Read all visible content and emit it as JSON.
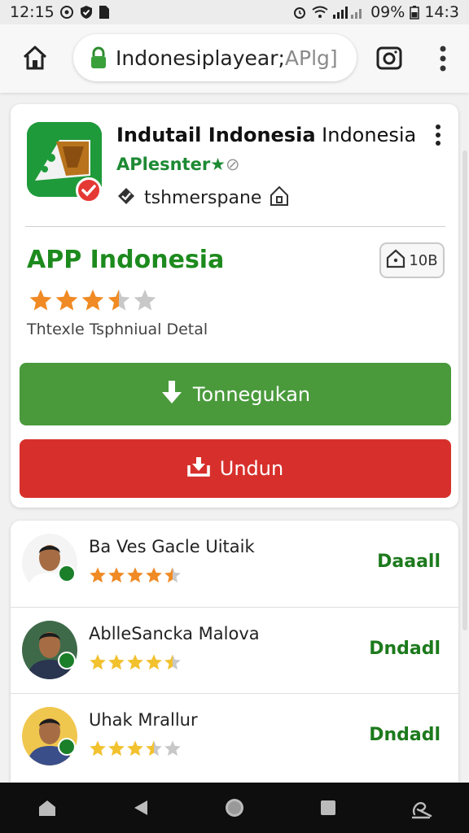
{
  "status_bar": {
    "time": "12:15",
    "battery_text": "09%",
    "extra_text": "14:3"
  },
  "browser": {
    "url_main": "Indonesiplayear;",
    "url_dim": "APlg]"
  },
  "app": {
    "title_bold": "Indutail Indonesia",
    "title_rest": "Indonesia",
    "developer": "APlesnter★",
    "developer_suffix": "⊘",
    "meta_text": "tshmerspane",
    "name": "APP Indonesia",
    "size": "10B",
    "rating": 3.5,
    "description": "Thtexle Tsphniual  Detal",
    "primary_button": "Tonnegukan",
    "secondary_button": "Undun"
  },
  "reviews": [
    {
      "name": "Ba Ves Gacle Uitaik",
      "rating": 4.5,
      "action": "Daaall",
      "avatar_bg": "#f4f4f4",
      "shirt": "#ffffff"
    },
    {
      "name": "AblleSancka Malova",
      "rating": 4.5,
      "action": "Dndadl",
      "avatar_bg": "#3f6a4a",
      "shirt": "#2a3550"
    },
    {
      "name": "Uhak Mrallur",
      "rating": 3.5,
      "action": "Dndadl",
      "avatar_bg": "#f0c74e",
      "shirt": "#3a4f8a"
    }
  ],
  "colors": {
    "accent_green": "#4a9a3c",
    "accent_red": "#d7302c",
    "star_orange": "#f08a24",
    "star_gold": "#f2c12e",
    "star_grey": "#c8c8c8"
  },
  "icons": {
    "home": "home-icon",
    "lock": "lock-icon",
    "tabs": "camera-icon",
    "menu": "more-vert-icon",
    "download": "download-arrow-icon",
    "undo": "download-tray-icon"
  }
}
